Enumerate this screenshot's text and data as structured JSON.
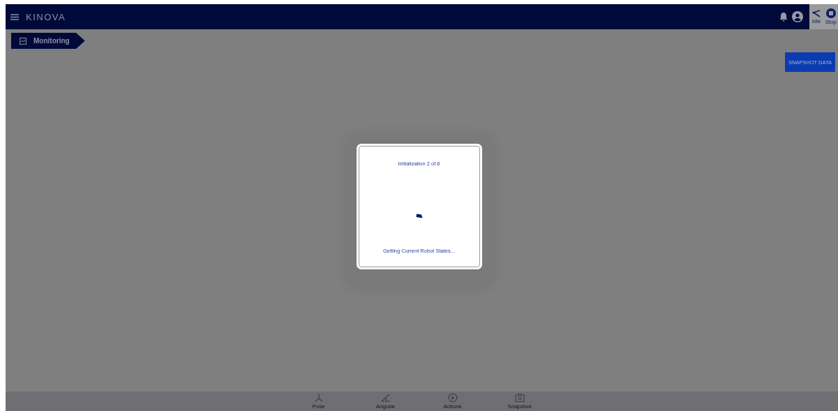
{
  "header": {
    "brand": "KINOVA",
    "status_items": [
      {
        "kind": "idle",
        "label": "Idle"
      },
      {
        "kind": "stop",
        "label": "Stop"
      }
    ]
  },
  "breadcrumb": {
    "label": "Monitoring"
  },
  "snapshot_button": {
    "label": "SNAPSHOT DATA"
  },
  "dialog": {
    "title": "Initialization 2 of 6",
    "message": "Getting Current Robot States..."
  },
  "bottom_nav": [
    {
      "kind": "pose",
      "label": "Pose"
    },
    {
      "kind": "angular",
      "label": "Angular"
    },
    {
      "kind": "actions",
      "label": "Actions"
    },
    {
      "kind": "snapshot",
      "label": "Snapshot"
    }
  ]
}
